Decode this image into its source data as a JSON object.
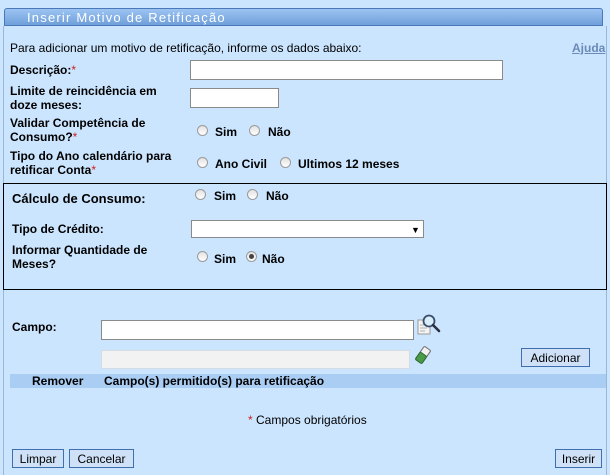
{
  "title": "Inserir Motivo de Retificação",
  "intro": "Para adicionar um motivo de retificação, informe os dados abaixo:",
  "help_link": "Ajuda",
  "required_mark": "*",
  "fields": {
    "descricao_label": "Descrição:",
    "descricao_value": "",
    "limite_line1": "Limite de reincidência em",
    "limite_line2": "doze meses:",
    "limite_value": "",
    "validar_line1": "Validar Competência de",
    "validar_line2": "Consumo?",
    "tipo_ano_line1": "Tipo do Ano calendário para",
    "tipo_ano_line2": "retificar Conta",
    "sim": "Sim",
    "nao": "Não",
    "ano_civil": "Ano Civil",
    "ultimos_12": "Ultimos 12 meses"
  },
  "consumo_section": {
    "calculo_label": "Cálculo de Consumo:",
    "tipo_credito_label": "Tipo de Crédito:",
    "tipo_credito_selected": "",
    "informar_line1": "Informar Quantidade de",
    "informar_line2": "Meses?",
    "informar_selected": "Não"
  },
  "campo": {
    "label": "Campo:",
    "value": "",
    "add_button": "Adicionar"
  },
  "table": {
    "headers": [
      "Remover",
      "Campo(s) permitido(s) para retificação"
    ]
  },
  "footer": {
    "required_note": "Campos obrigatórios",
    "limpar": "Limpar",
    "cancelar": "Cancelar",
    "inserir": "Inserir"
  }
}
